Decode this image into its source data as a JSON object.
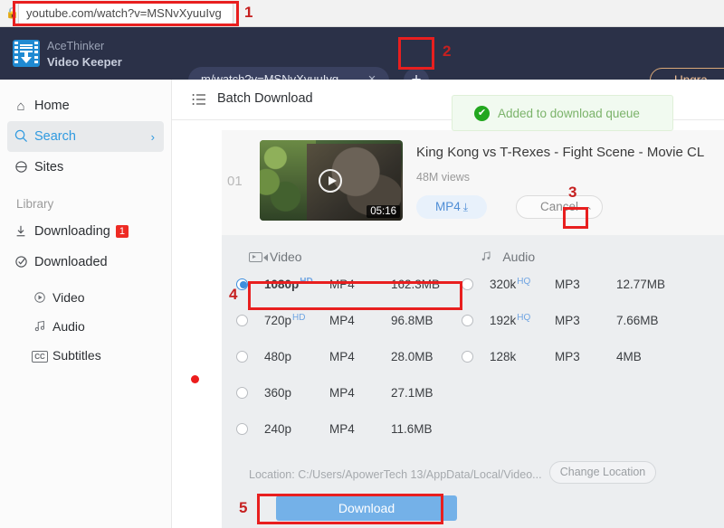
{
  "browser": {
    "lock_icon": "padlock-icon",
    "url": "youtube.com/watch?v=MSNvXyuuIvg"
  },
  "header": {
    "brand_line1": "AceThinker",
    "brand_line2": "Video Keeper",
    "tab_label": "m/watch?v=MSNvXyuuIvg",
    "tab_close": "×",
    "add_tab": "+",
    "upgrade_label": "Upgra",
    "crown": "♛",
    "bg": "#2b3148"
  },
  "sidebar": {
    "items": [
      {
        "label": "Home",
        "icon": "home-icon",
        "glyph": "⌂",
        "active": false
      },
      {
        "label": "Search",
        "icon": "search-icon",
        "glyph": "○",
        "active": true,
        "chevron": "›"
      },
      {
        "label": "Sites",
        "icon": "globe-icon",
        "glyph": "◑",
        "active": false
      }
    ],
    "section_label": "Library",
    "library": [
      {
        "label": "Downloading",
        "icon": "download-icon",
        "glyph": "↓",
        "badge": "1"
      },
      {
        "label": "Downloaded",
        "icon": "check-circle-icon",
        "glyph": "✓",
        "badge": ""
      }
    ],
    "sub_items": [
      {
        "label": "Video",
        "icon": "play-circle-icon",
        "glyph": "▶"
      },
      {
        "label": "Audio",
        "icon": "music-note-icon",
        "glyph": "♫"
      },
      {
        "label": "Subtitles",
        "icon": "closed-caption-icon",
        "glyph": "CC"
      }
    ]
  },
  "main": {
    "batch_title": "Batch Download",
    "batch_icon": "list-icon",
    "toast": {
      "text": "Added to download queue",
      "icon": "check-icon",
      "glyph": "✔",
      "bg": "#f1faf0",
      "color": "#7bb36a"
    },
    "card": {
      "index": "01",
      "duration": "05:16",
      "title": "King Kong vs T-Rexes - Fight Scene - Movie CL",
      "views": "48M views",
      "format_pill": "MP4",
      "format_pill_icon": "download-icon",
      "format_pill_glyph": "⤓",
      "cancel_label": "Cancel",
      "cancel_caret": "⌃"
    },
    "panel": {
      "video_header": "Video",
      "audio_header": "Audio",
      "video_options": [
        {
          "quality": "1080p",
          "tag": "HD",
          "format": "MP4",
          "size": "162.3MB",
          "selected": true
        },
        {
          "quality": "720p",
          "tag": "HD",
          "format": "MP4",
          "size": "96.8MB",
          "selected": false
        },
        {
          "quality": "480p",
          "tag": "",
          "format": "MP4",
          "size": "28.0MB",
          "selected": false
        },
        {
          "quality": "360p",
          "tag": "",
          "format": "MP4",
          "size": "27.1MB",
          "selected": false
        },
        {
          "quality": "240p",
          "tag": "",
          "format": "MP4",
          "size": "11.6MB",
          "selected": false
        }
      ],
      "audio_options": [
        {
          "quality": "320k",
          "tag": "HQ",
          "format": "MP3",
          "size": "12.77MB",
          "selected": false
        },
        {
          "quality": "192k",
          "tag": "HQ",
          "format": "MP3",
          "size": "7.66MB",
          "selected": false
        },
        {
          "quality": "128k",
          "tag": "",
          "format": "MP3",
          "size": "4MB",
          "selected": false
        }
      ],
      "location_text": "Location: C:/Users/ApowerTech 13/AppData/Local/Video...",
      "change_location_label": "Change Location",
      "download_label": "Download"
    }
  },
  "annotations": {
    "color": "#e81f1f",
    "numbers": [
      "1",
      "2",
      "3",
      "4",
      "5"
    ]
  }
}
